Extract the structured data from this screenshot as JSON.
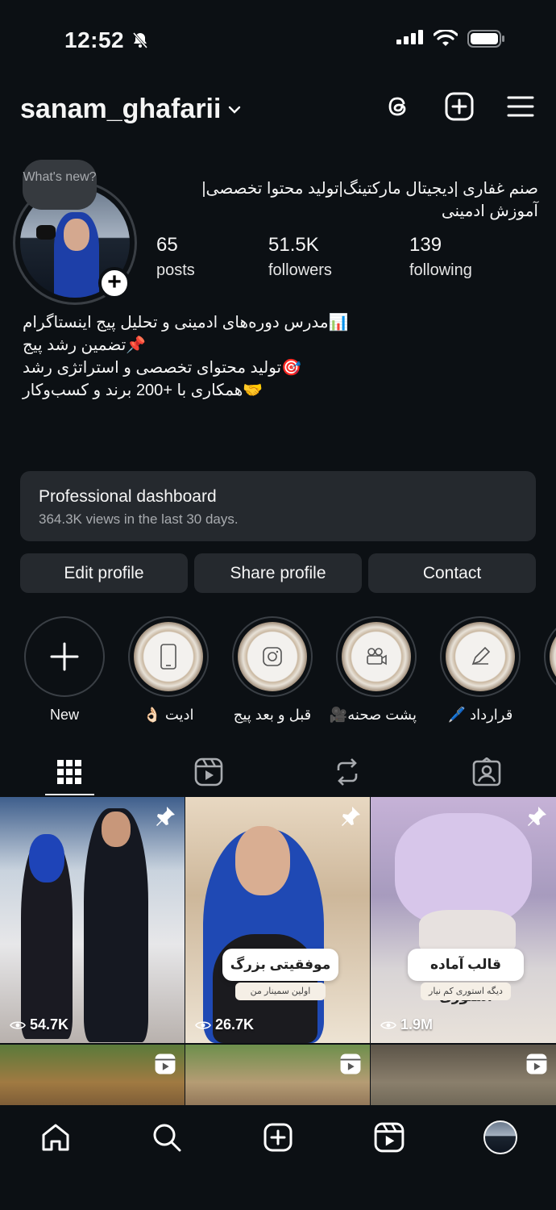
{
  "status_bar": {
    "time": "12:52"
  },
  "header": {
    "username": "sanam_ghafarii"
  },
  "profile": {
    "note": "What's new?",
    "display_name": "صنم غفاری |دیجیتال مارکتینگ|تولید محتوا تخصصی| آموزش ادمینی",
    "stats": [
      {
        "value": "65",
        "label": "posts"
      },
      {
        "value": "51.5K",
        "label": "followers"
      },
      {
        "value": "139",
        "label": "following"
      }
    ],
    "bio": [
      "📊مدرس دوره‌های ادمینی و تحلیل پیج اینستاگرام",
      "📌تضمین رشد پیج",
      "🎯تولید محتوای تخصصی و استراتژی رشد",
      "🤝همکاری با +200 برند و کسب‌وکار"
    ]
  },
  "dashboard": {
    "title": "Professional dashboard",
    "subtitle": "364.3K views in the last 30 days."
  },
  "buttons": {
    "edit": "Edit profile",
    "share": "Share profile",
    "contact": "Contact"
  },
  "highlights": [
    {
      "label": "New",
      "icon": "plus-icon"
    },
    {
      "label": "ادیت 👌🏻",
      "icon": "phone-icon"
    },
    {
      "label": "قبل و بعد پیج",
      "icon": "instagram-icon"
    },
    {
      "label": "پشت صحنه🎥",
      "icon": "camera-icon"
    },
    {
      "label": "قرارداد 🖊️",
      "icon": "pen-icon"
    }
  ],
  "tabs": [
    "grid-icon",
    "reels-icon",
    "reposts-icon",
    "tagged-icon"
  ],
  "posts": [
    {
      "views": "54.7K",
      "pinned": true
    },
    {
      "views": "26.7K",
      "pinned": true,
      "caption": "موفقیتی بزرگ",
      "sub": "اولین سمینار من"
    },
    {
      "views": "1.9M",
      "pinned": true,
      "caption": "قالب آماده استوری",
      "sub": "دیگه استوری کم نیار"
    }
  ],
  "bottom_nav": [
    "home-icon",
    "search-icon",
    "create-icon",
    "reels-icon",
    "profile-avatar"
  ]
}
